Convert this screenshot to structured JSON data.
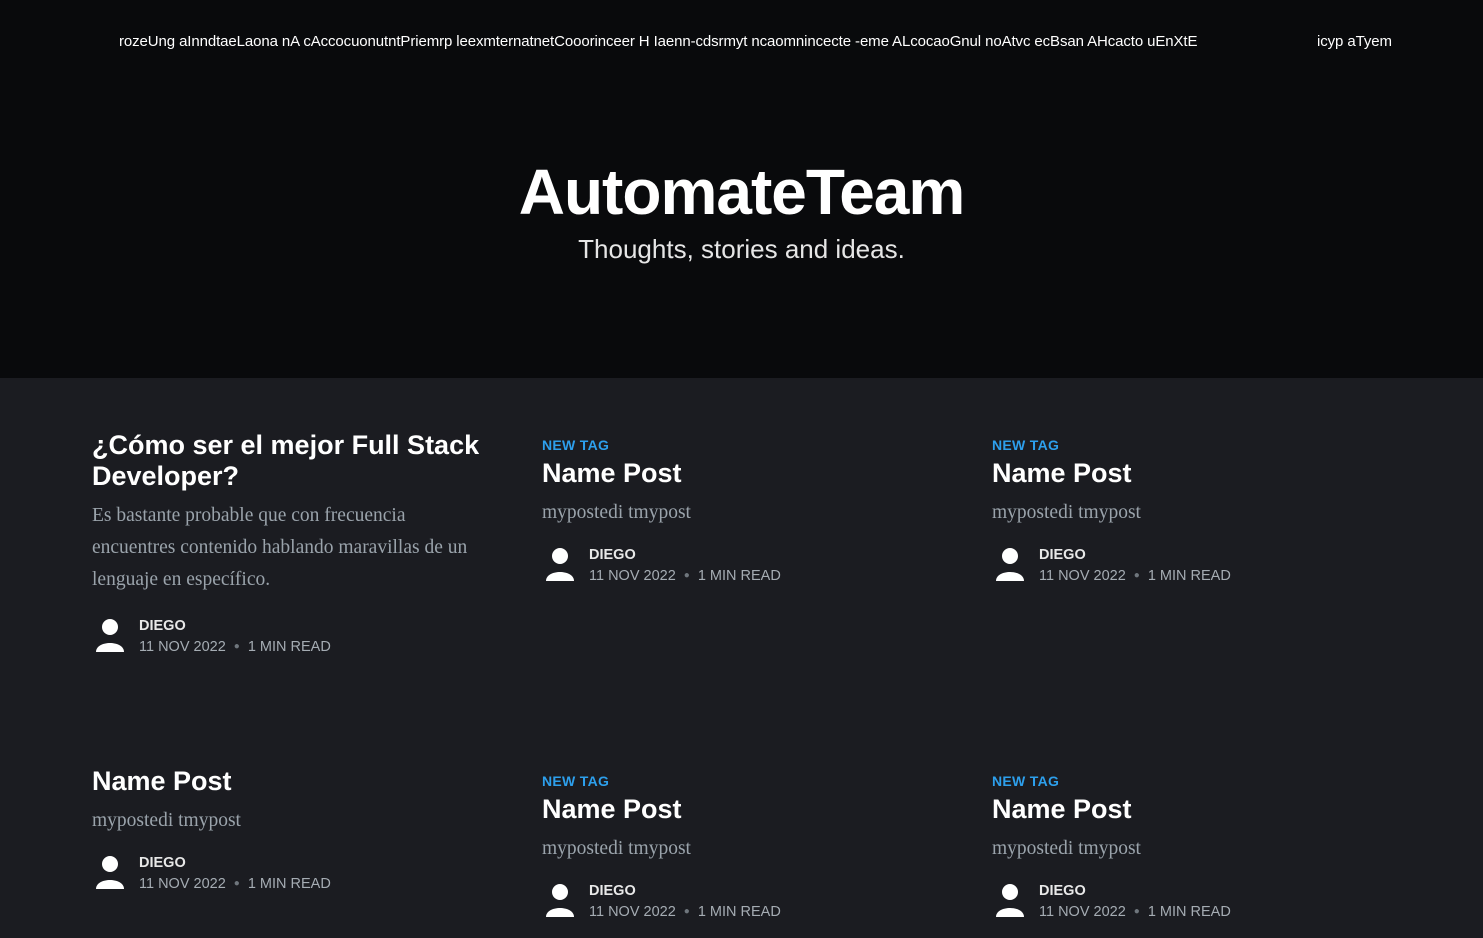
{
  "nav": {
    "items_text": "rozeUng aInndtaeLaona nA cAccocuonutntPriemrp leexmternatnetCooorinceer H Iaenn-cdsrmyt ncaomnincecte -eme ALcocaoGnul noAtvc ecBsan AHcacto uEnXtE",
    "more_text": "icyp aTyem"
  },
  "site": {
    "title": "AutomateTeam",
    "description": "Thoughts, stories and ideas."
  },
  "posts": [
    {
      "tag": "",
      "title": "¿Cómo ser el mejor Full Stack Developer?",
      "excerpt": "Es bastante probable que con frecuencia encuentres contenido hablando maravillas de un lenguaje en específico.",
      "author": "DIEGO",
      "date": "11 NOV 2022",
      "read_time": "1 MIN READ"
    },
    {
      "tag": "NEW TAG",
      "title": "Name Post",
      "excerpt": "mypostedi tmypost",
      "author": "DIEGO",
      "date": "11 NOV 2022",
      "read_time": "1 MIN READ"
    },
    {
      "tag": "NEW TAG",
      "title": "Name Post",
      "excerpt": "mypostedi tmypost",
      "author": "DIEGO",
      "date": "11 NOV 2022",
      "read_time": "1 MIN READ"
    },
    {
      "tag": "",
      "title": "Name Post",
      "excerpt": "mypostedi tmypost",
      "author": "DIEGO",
      "date": "11 NOV 2022",
      "read_time": "1 MIN READ"
    },
    {
      "tag": "NEW TAG",
      "title": "Name Post",
      "excerpt": "mypostedi tmypost",
      "author": "DIEGO",
      "date": "11 NOV 2022",
      "read_time": "1 MIN READ"
    },
    {
      "tag": "NEW TAG",
      "title": "Name Post",
      "excerpt": "mypostedi tmypost",
      "author": "DIEGO",
      "date": "11 NOV 2022",
      "read_time": "1 MIN READ"
    }
  ],
  "colors": {
    "header_bg": "#090a0c",
    "body_bg": "#1b1c21",
    "tag_accent": "#2d9fec",
    "excerpt_text": "#9aa3ab"
  },
  "icons": {
    "avatar": "avatar-icon"
  }
}
